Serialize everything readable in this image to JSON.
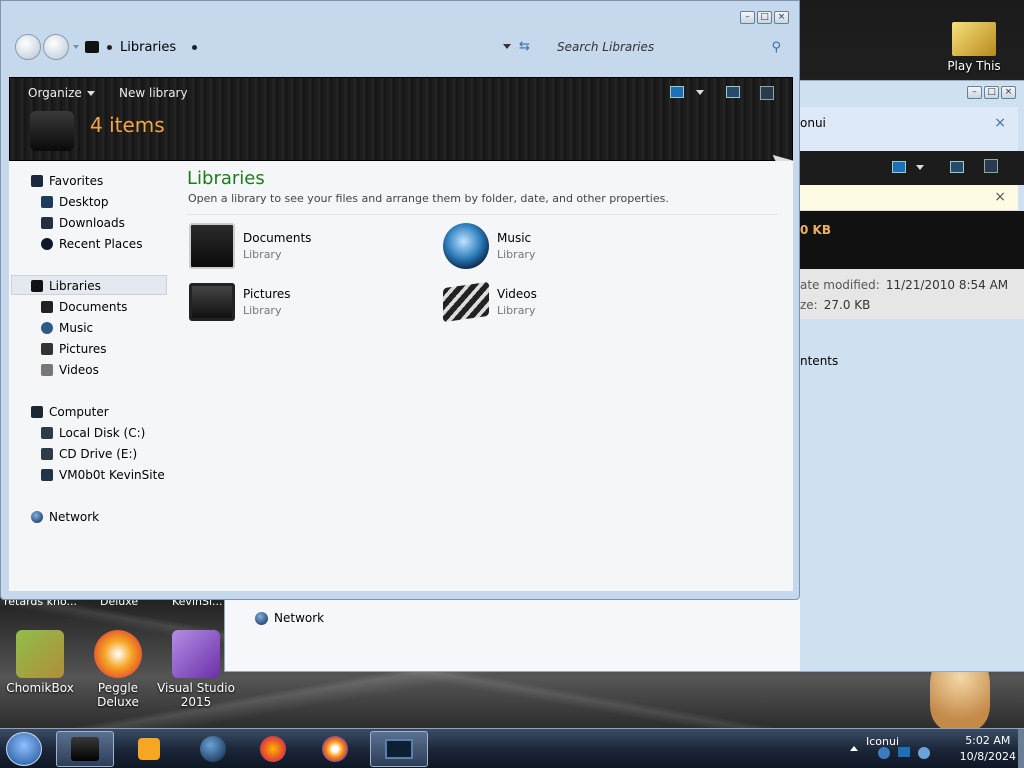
{
  "desktop": {
    "icons": [
      {
        "label": "Play This",
        "color": "#e7c23a"
      },
      {
        "label": "ChomikBox",
        "color": "#b18d3a"
      },
      {
        "label": "Peggle Deluxe",
        "color": "#e24a2f"
      },
      {
        "label": "Visual Studio 2015",
        "color": "#6b2fa8"
      }
    ],
    "clipped_labels": [
      "retards kno...",
      "Deluxe",
      "KevinSi..."
    ]
  },
  "background_window": {
    "title_partial": "onui",
    "preview_text_partial": "0 KB",
    "date_modified_label": "ate modified:",
    "date_modified_value": "11/21/2010 8:54 AM",
    "size_label": "ze:",
    "size_value": "27.0 KB",
    "contents_partial": "ntents",
    "network_label": "Network",
    "close_glyph": "×"
  },
  "window": {
    "breadcrumb": "Libraries",
    "search_placeholder": "Search Libraries",
    "caption_buttons": {
      "minimize": "–",
      "maximize": "□",
      "close": "×"
    },
    "commandbar": {
      "organize": "Organize",
      "new_library": "New library",
      "item_count": "4 items"
    },
    "navpane": {
      "favorites": "Favorites",
      "desktop": "Desktop",
      "downloads": "Downloads",
      "recent_places": "Recent Places",
      "libraries": "Libraries",
      "documents": "Documents",
      "music": "Music",
      "pictures": "Pictures",
      "videos": "Videos",
      "computer": "Computer",
      "local_disk": "Local Disk (C:)",
      "cd_drive": "CD Drive (E:)",
      "kevinsite": "VM0b0t KevinSite",
      "network": "Network"
    },
    "main": {
      "title": "Libraries",
      "description": "Open a library to see your files and arrange them by folder, date, and other properties.",
      "libraries": [
        {
          "name": "Documents",
          "kind": "Library",
          "icon": "documents-icon"
        },
        {
          "name": "Music",
          "kind": "Library",
          "icon": "music-icon"
        },
        {
          "name": "Pictures",
          "kind": "Library",
          "icon": "pictures-icon"
        },
        {
          "name": "Videos",
          "kind": "Library",
          "icon": "videos-icon"
        }
      ]
    }
  },
  "taskbar": {
    "tray_label": "Iconui",
    "time": "5:02 AM",
    "date": "10/8/2024"
  },
  "colors": {
    "accent_green": "#1e7a1e",
    "count_orange": "#f3a648"
  }
}
